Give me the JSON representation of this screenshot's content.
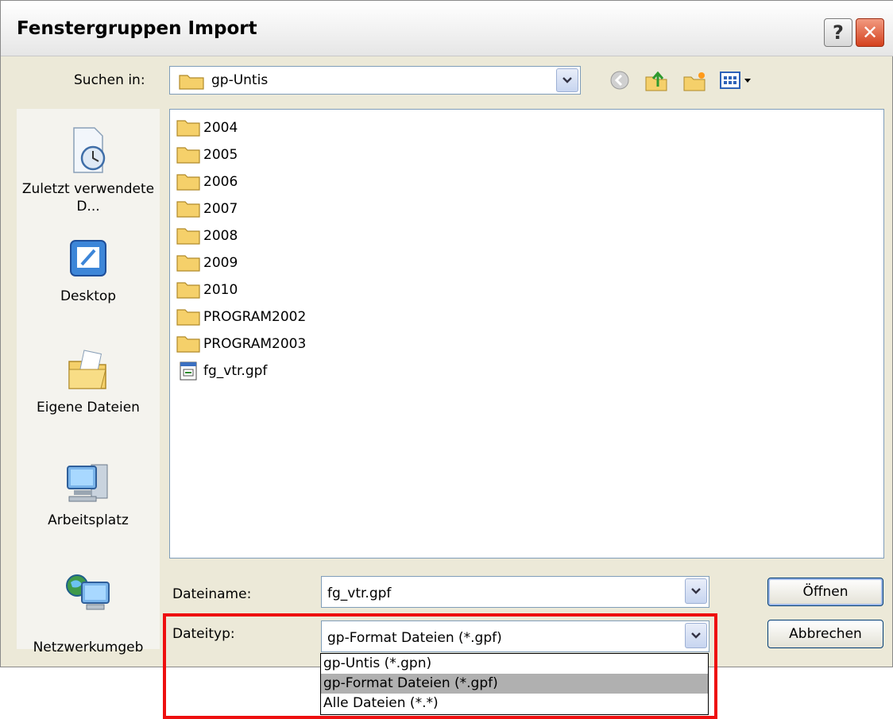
{
  "dialog": {
    "title": "Fenstergruppen Import"
  },
  "titlebar": {
    "help_label": "?",
    "close_label": "✕"
  },
  "lookin": {
    "label": "Suchen in:",
    "value": "gp-Untis"
  },
  "toolbar": {
    "back_icon": "back-icon",
    "up_icon": "up-folder-icon",
    "new_folder_icon": "new-folder-icon",
    "view_icon": "view-menu-icon"
  },
  "places": [
    {
      "label": "Zuletzt verwendete D...",
      "icon": "recent-documents-icon"
    },
    {
      "label": "Desktop",
      "icon": "desktop-icon"
    },
    {
      "label": "Eigene Dateien",
      "icon": "my-documents-icon"
    },
    {
      "label": "Arbeitsplatz",
      "icon": "my-computer-icon"
    },
    {
      "label": "Netzwerkumgeb",
      "icon": "network-icon"
    }
  ],
  "files": [
    {
      "name": "2004",
      "type": "folder"
    },
    {
      "name": "2005",
      "type": "folder"
    },
    {
      "name": "2006",
      "type": "folder"
    },
    {
      "name": "2007",
      "type": "folder"
    },
    {
      "name": "2008",
      "type": "folder"
    },
    {
      "name": "2009",
      "type": "folder"
    },
    {
      "name": "2010",
      "type": "folder"
    },
    {
      "name": "PROGRAM2002",
      "type": "folder"
    },
    {
      "name": "PROGRAM2003",
      "type": "folder"
    },
    {
      "name": "fg_vtr.gpf",
      "type": "file"
    }
  ],
  "filename": {
    "label": "Dateiname:",
    "value": "fg_vtr.gpf"
  },
  "filetype": {
    "label": "Dateityp:",
    "value": "gp-Format Dateien (*.gpf)",
    "options": [
      "gp-Untis (*.gpn)",
      "gp-Format Dateien (*.gpf)",
      "Alle Dateien (*.*)"
    ],
    "selected_index": 1
  },
  "buttons": {
    "open": "Öffnen",
    "cancel": "Abbrechen"
  },
  "colors": {
    "highlight": "#ee0f0f",
    "folder": "#f5d06a",
    "selection": "#b0b0b0"
  }
}
